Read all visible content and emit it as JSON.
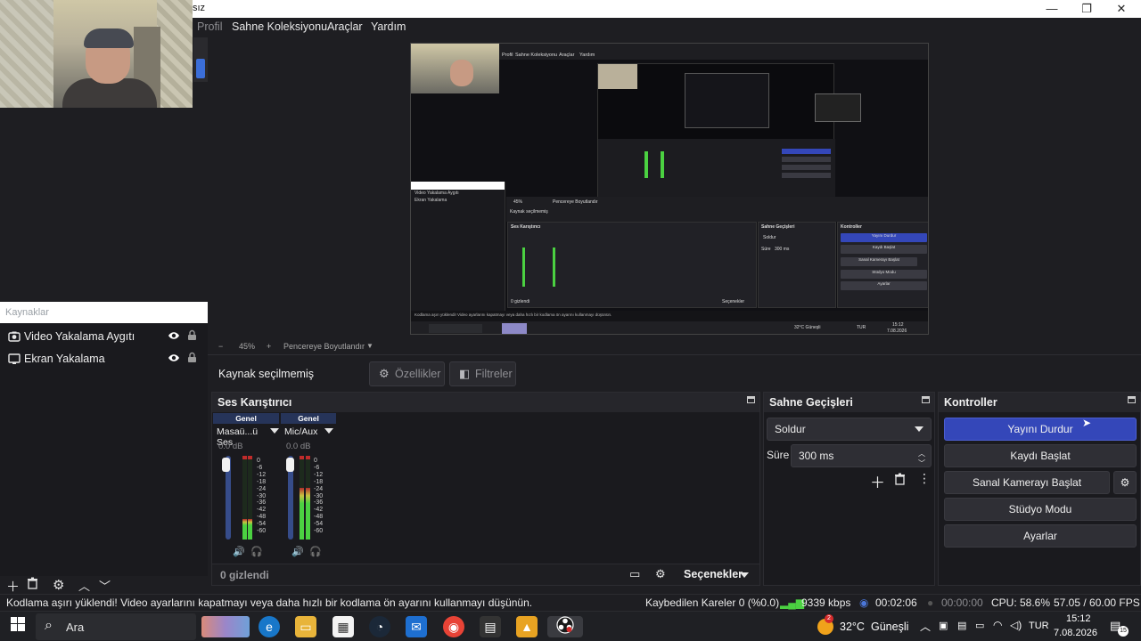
{
  "window": {
    "title": "sız",
    "controls": [
      "—",
      "❐",
      "✕"
    ]
  },
  "menu": [
    "Profil",
    "Sahne Koleksiyonu",
    "Araçlar",
    "Yardım"
  ],
  "sources": {
    "header": "Kaynaklar",
    "items": [
      {
        "label": "Video Yakalama Aygıtı",
        "icon": "camera-icon"
      },
      {
        "label": "Ekran Yakalama",
        "icon": "monitor-icon"
      }
    ]
  },
  "zoom": {
    "minus": "−",
    "value": "45%",
    "plus": "+",
    "fit": "Pencereye Boyutlandır"
  },
  "context": {
    "no_source": "Kaynak seçilmemiş",
    "properties": "Özellikler",
    "filters": "Filtreler"
  },
  "mixer": {
    "title": "Ses Karıştırıcı",
    "channels": [
      {
        "category": "Genel",
        "name": "Masaü...ü Ses",
        "db": "0.0 dB",
        "level": 0.25
      },
      {
        "category": "Genel",
        "name": "Mic/Aux",
        "db": "0.0 dB",
        "level": 0.62
      }
    ],
    "ticks": [
      "0",
      "-6",
      "-12",
      "-18",
      "-24",
      "-30",
      "-36",
      "-42",
      "-48",
      "-54",
      "-60"
    ],
    "hidden": "0 gizlendi",
    "options": "Seçenekler"
  },
  "transitions": {
    "title": "Sahne Geçişleri",
    "type": "Soldur",
    "duration_label": "Süre",
    "duration_value": "300 ms"
  },
  "controls": {
    "title": "Kontroller",
    "stop_stream": "Yayını Durdur",
    "start_record": "Kaydı Başlat",
    "virtual_cam": "Sanal Kamerayı Başlat",
    "studio_mode": "Stüdyo Modu",
    "settings": "Ayarlar"
  },
  "status": {
    "message": "Kodlama aşırı yüklendi! Video ayarlarını kapatmayı veya daha hızlı bir kodlama ön ayarını kullanmayı düşünün.",
    "dropped": "Kaybedilen Kareler 0 (%0.0)",
    "bitrate": "9339 kbps",
    "stream_time": "00:02:06",
    "rec_time": "00:00:00",
    "cpu": "CPU: 58.6%",
    "fps": "57.05 / 60.00 FPS"
  },
  "preview_mini": {
    "menu": [
      "Profil",
      "Sahne Koleksiyonu",
      "Araçlar",
      "Yardım"
    ],
    "sources": [
      "Video Yakalama Aygıtı",
      "Ekran Yakalama"
    ],
    "no_source": "Kaynak seçilmemiş",
    "mixer": "Ses Karıştırıcı",
    "transitions": "Sahne Geçişleri",
    "controls": "Kontroller",
    "buttons": [
      "Yayını Durdur",
      "Kaydı Başlat",
      "Sanal Kamerayı Başlat",
      "Stüdyo Modu",
      "Ayarlar"
    ],
    "transition_type": "Soldur",
    "duration_label": "Süre",
    "duration_value": "300 ms",
    "hidden": "0 gizlendi",
    "options": "Seçenekler",
    "status": "Kodlama aşırı yüklendi! Video ayarlarını kapatmayı veya daha hızlı bir kodlama ön ayarını kullanmayı düşünün.",
    "zoom": "45%",
    "fit": "Pencereye Boyutlandır",
    "weather": "32°C Güneşli",
    "lang": "TUR",
    "time": "15:12",
    "date": "7.08.2026"
  },
  "taskbar": {
    "search": "Ara",
    "weather_temp": "32°C",
    "weather_text": "Güneşli",
    "weather_badge": "2",
    "lang": "TUR",
    "time": "15:12",
    "date": "7.08.2026",
    "notifications": "15"
  },
  "colors": {
    "accent": "#3447b9",
    "mixer_category": "#263459",
    "meter_green": "#4bd141",
    "meter_red": "#b32c2c"
  }
}
